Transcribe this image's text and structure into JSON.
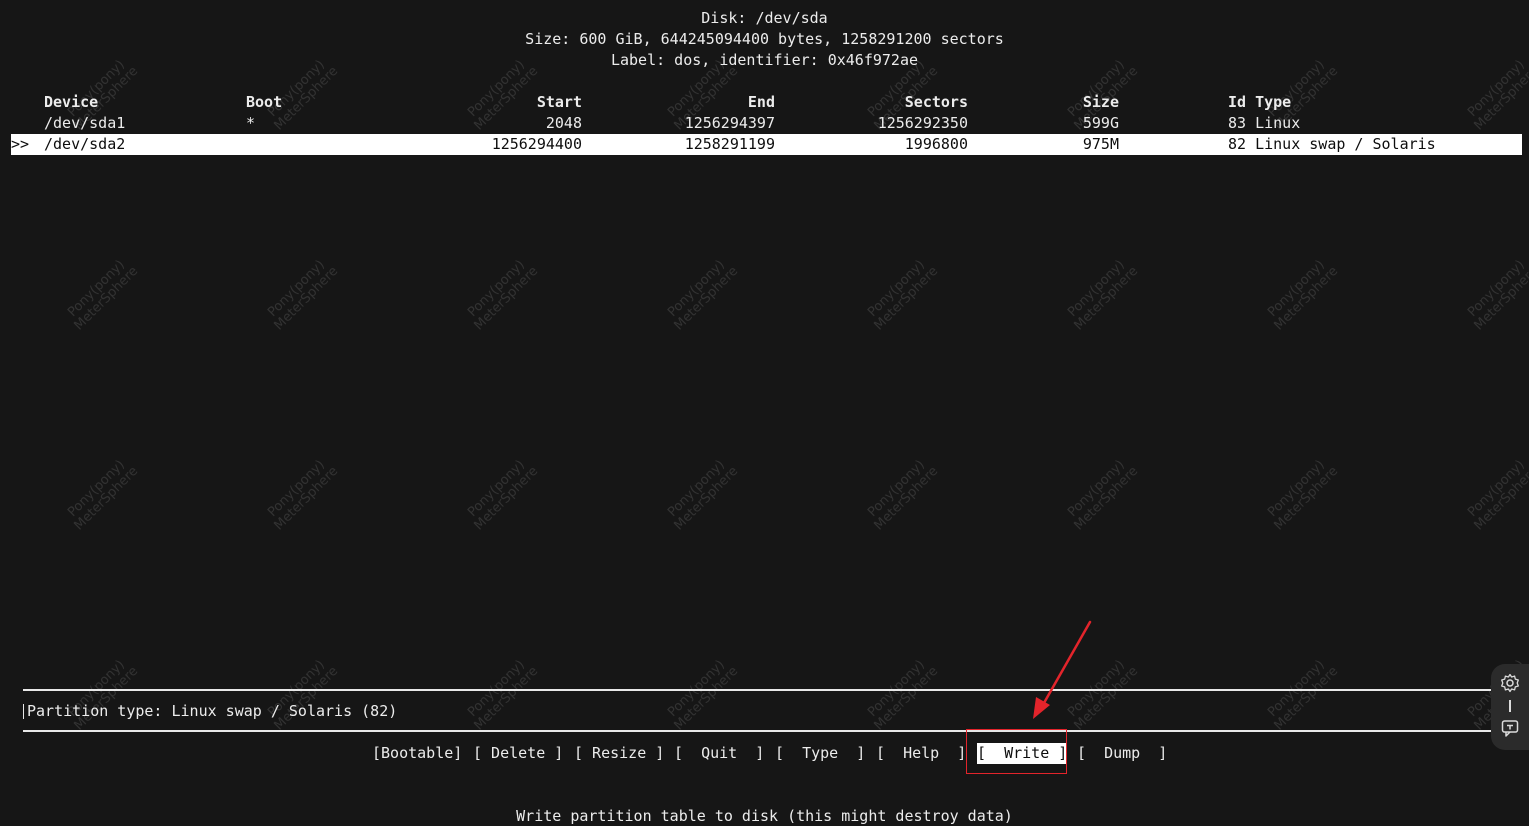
{
  "disk_info": {
    "line1": "Disk: /dev/sda",
    "line2": "Size: 600 GiB, 644245094400 bytes, 1258291200 sectors",
    "line3": "Label: dos, identifier: 0x46f972ae"
  },
  "table": {
    "columns": [
      "Device",
      "Boot",
      "Start",
      "End",
      "Sectors",
      "Size",
      "Id Type"
    ],
    "rows": [
      {
        "cursor": "",
        "device": "/dev/sda1",
        "boot": "*",
        "start": "2048",
        "end": "1256294397",
        "sectors": "1256292350",
        "size": "599G",
        "idtype": "83 Linux"
      },
      {
        "cursor": ">>",
        "device": "/dev/sda2",
        "boot": "",
        "start": "1256294400",
        "end": "1258291199",
        "sectors": "1996800",
        "size": "975M",
        "idtype": "82 Linux swap / Solaris"
      }
    ]
  },
  "status": {
    "text": "Partition type: Linux swap / Solaris (82)"
  },
  "menu": {
    "bootable": "[Bootable]",
    "delete": "[ Delete ]",
    "resize": "[ Resize ]",
    "quit": "[  Quit  ]",
    "type": "[  Type  ]",
    "help": "[  Help  ]",
    "write": "[  Write ]",
    "dump": "[  Dump  ]"
  },
  "hint": "Write partition table to disk (this might destroy data)",
  "watermark": "Pony(pony)\nMeterSphere",
  "colors": {
    "background": "#161616",
    "text": "#ececec",
    "selection": "#ffffff",
    "annotation_red": "#e3242b"
  },
  "icons": {
    "settings": "gear-icon",
    "feedback": "feedback-icon"
  }
}
